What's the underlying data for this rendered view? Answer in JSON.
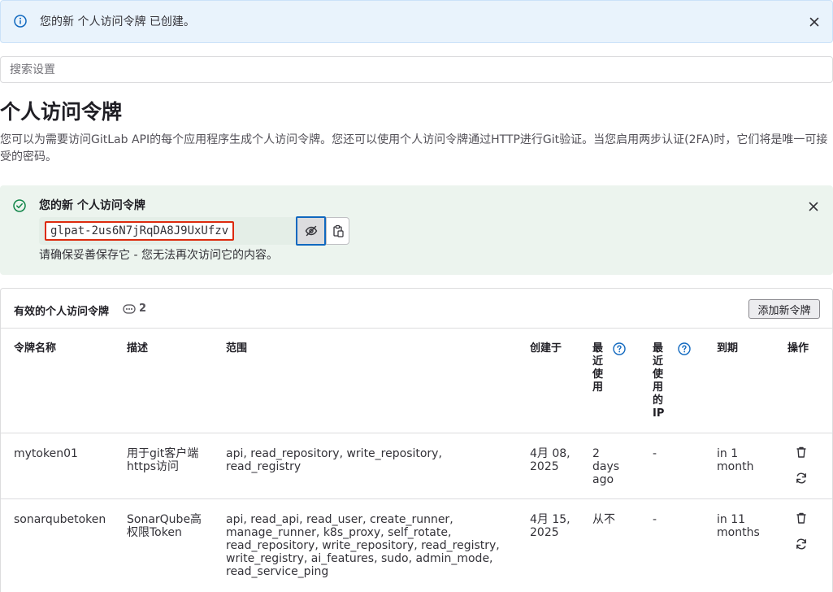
{
  "colors": {
    "info_bg": "#e9f3fc",
    "info_accent": "#1068bf",
    "success_bg": "#ecf4ee",
    "success_accent": "#108548",
    "danger_border": "#dd2b0e"
  },
  "info_alert": {
    "message": "您的新 个人访问令牌 已创建。",
    "icon": "info-circle-icon"
  },
  "search": {
    "placeholder": "搜索设置"
  },
  "page": {
    "title": "个人访问令牌",
    "description": "您可以为需要访问GitLab API的每个应用程序生成个人访问令牌。您还可以使用个人访问令牌通过HTTP进行Git验证。当您启用两步认证(2FA)时，它们将是唯一可接受的密码。"
  },
  "new_token": {
    "title": "您的新 个人访问令牌",
    "value": "glpat-2us6N7jRqDA8J9UxUfzv",
    "note": "请确保妥善保存它 - 您无法再次访问它的内容。",
    "icon": "check-circle-icon"
  },
  "tokens_card": {
    "title": "有效的个人访问令牌",
    "count": "2",
    "add_button": "添加新令牌",
    "columns": {
      "name": "令牌名称",
      "description": "描述",
      "scopes": "范围",
      "created": "创建于",
      "last_used": "最近使用",
      "last_used_ip": "最近使用的IP",
      "expires": "到期",
      "actions": "操作"
    },
    "rows": [
      {
        "name": "mytoken01",
        "description": "用于git客户端https访问",
        "scopes": "api, read_repository, write_repository, read_registry",
        "created": "4月 08, 2025",
        "last_used": "2 days ago",
        "last_used_ip": "-",
        "expires": "in 1 month"
      },
      {
        "name": "sonarqubetoken",
        "description": "SonarQube高权限Token",
        "scopes": "api, read_api, read_user, create_runner, manage_runner, k8s_proxy, self_rotate, read_repository, write_repository, read_registry, write_registry, ai_features, sudo, admin_mode, read_service_ping",
        "created": "4月 15, 2025",
        "last_used": "从不",
        "last_used_ip": "-",
        "expires": "in 11 months"
      }
    ]
  }
}
